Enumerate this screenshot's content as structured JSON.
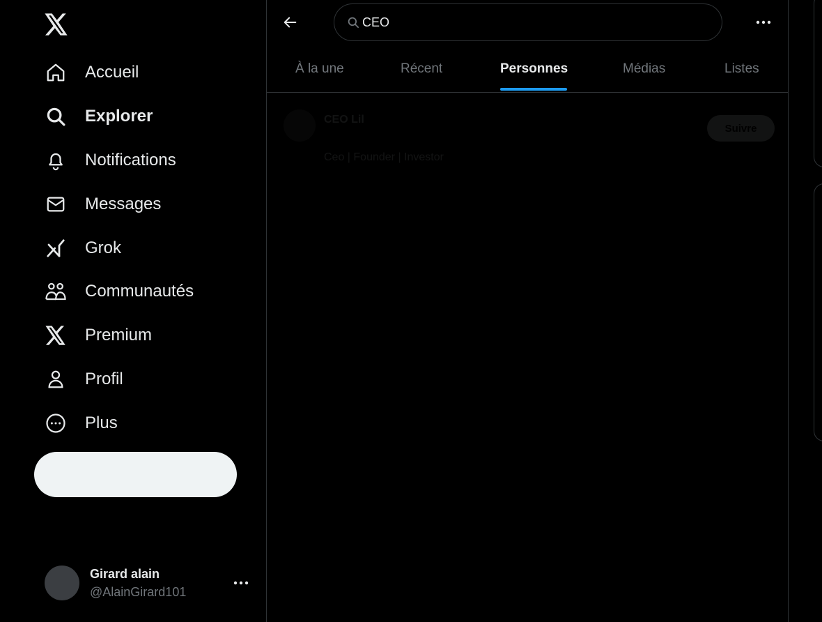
{
  "sidebar": {
    "logo": "x-logo-icon",
    "items": [
      {
        "label": "Accueil",
        "icon": "home-icon"
      },
      {
        "label": "Explorer",
        "icon": "search-icon",
        "active": true
      },
      {
        "label": "Notifications",
        "icon": "bell-icon"
      },
      {
        "label": "Messages",
        "icon": "envelope-icon"
      },
      {
        "label": "Grok",
        "icon": "grok-icon"
      },
      {
        "label": "Communautés",
        "icon": "people-icon"
      },
      {
        "label": "Premium",
        "icon": "x-logo-icon"
      },
      {
        "label": "Profil",
        "icon": "person-icon"
      },
      {
        "label": "Plus",
        "icon": "more-circle-icon"
      }
    ],
    "post_label": ""
  },
  "account": {
    "name": "Girard alain",
    "handle": "@AlainGirard101"
  },
  "search": {
    "value": "CEO"
  },
  "tabs": [
    {
      "label": "À la une"
    },
    {
      "label": "Récent"
    },
    {
      "label": "Personnes",
      "active": true
    },
    {
      "label": "Médias"
    },
    {
      "label": "Listes"
    }
  ],
  "result": {
    "name": "CEO Lil",
    "bio": "Ceo | Founder | Investor",
    "follow_label": "Suivre"
  },
  "colors": {
    "background": "#000000",
    "accent": "#1d9bf0",
    "text": "#e7e9ea",
    "muted": "#71767b",
    "border": "#2f3336"
  }
}
